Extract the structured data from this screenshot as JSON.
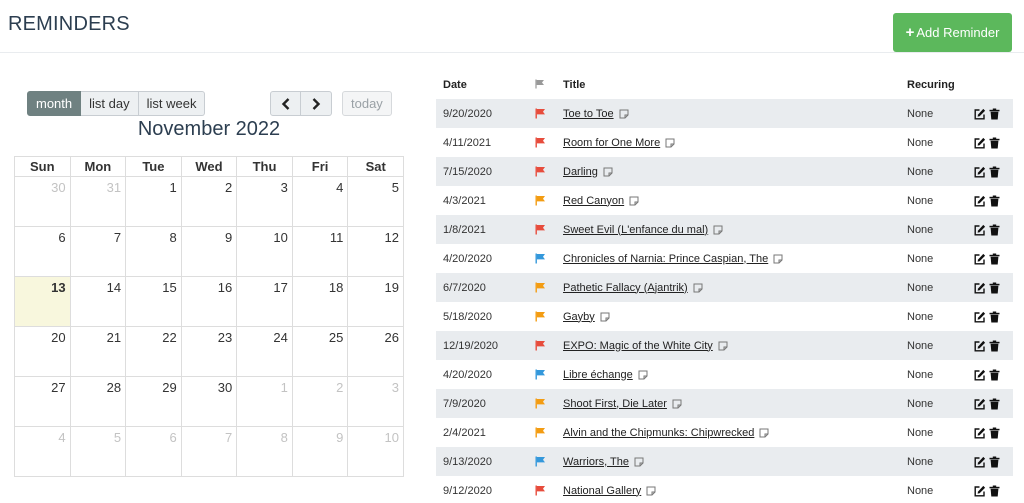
{
  "header": {
    "title": "REMINDERS",
    "add_button": "Add Reminder"
  },
  "colors": {
    "accent_green": "#5cb85c",
    "active_view": "#6f8181",
    "today_highlight": "#f8f7dd",
    "flag_red": "#e74c3c",
    "flag_orange": "#f39c12",
    "flag_blue": "#3498db",
    "stripe": "#e9ecef"
  },
  "calendar": {
    "views": [
      "month",
      "list day",
      "list week"
    ],
    "active_view": "month",
    "today_label": "today",
    "title": "November 2022",
    "weekdays": [
      "Sun",
      "Mon",
      "Tue",
      "Wed",
      "Thu",
      "Fri",
      "Sat"
    ],
    "weeks": [
      [
        {
          "d": "30",
          "o": true
        },
        {
          "d": "31",
          "o": true
        },
        {
          "d": "1"
        },
        {
          "d": "2"
        },
        {
          "d": "3"
        },
        {
          "d": "4"
        },
        {
          "d": "5"
        }
      ],
      [
        {
          "d": "6"
        },
        {
          "d": "7"
        },
        {
          "d": "8"
        },
        {
          "d": "9"
        },
        {
          "d": "10"
        },
        {
          "d": "11"
        },
        {
          "d": "12"
        }
      ],
      [
        {
          "d": "13",
          "t": true
        },
        {
          "d": "14"
        },
        {
          "d": "15"
        },
        {
          "d": "16"
        },
        {
          "d": "17"
        },
        {
          "d": "18"
        },
        {
          "d": "19"
        }
      ],
      [
        {
          "d": "20"
        },
        {
          "d": "21"
        },
        {
          "d": "22"
        },
        {
          "d": "23"
        },
        {
          "d": "24"
        },
        {
          "d": "25"
        },
        {
          "d": "26"
        }
      ],
      [
        {
          "d": "27"
        },
        {
          "d": "28"
        },
        {
          "d": "29"
        },
        {
          "d": "30"
        },
        {
          "d": "1",
          "o": true
        },
        {
          "d": "2",
          "o": true
        },
        {
          "d": "3",
          "o": true
        }
      ],
      [
        {
          "d": "4",
          "o": true
        },
        {
          "d": "5",
          "o": true
        },
        {
          "d": "6",
          "o": true
        },
        {
          "d": "7",
          "o": true
        },
        {
          "d": "8",
          "o": true
        },
        {
          "d": "9",
          "o": true
        },
        {
          "d": "10",
          "o": true
        }
      ]
    ]
  },
  "reminders": {
    "columns": {
      "date": "Date",
      "flag_icon": "flag-icon",
      "title": "Title",
      "recurring": "Recuring"
    },
    "rows": [
      {
        "date": "9/20/2020",
        "flag": "red",
        "title": "Toe to Toe",
        "recurring": "None"
      },
      {
        "date": "4/11/2021",
        "flag": "red",
        "title": "Room for One More",
        "recurring": "None"
      },
      {
        "date": "7/15/2020",
        "flag": "red",
        "title": "Darling",
        "recurring": "None"
      },
      {
        "date": "4/3/2021",
        "flag": "orange",
        "title": "Red Canyon",
        "recurring": "None"
      },
      {
        "date": "1/8/2021",
        "flag": "red",
        "title": "Sweet Evil (L'enfance du mal)",
        "recurring": "None"
      },
      {
        "date": "4/20/2020",
        "flag": "blue",
        "title": "Chronicles of Narnia: Prince Caspian, The",
        "recurring": "None"
      },
      {
        "date": "6/7/2020",
        "flag": "orange",
        "title": "Pathetic Fallacy (Ajantrik)",
        "recurring": "None"
      },
      {
        "date": "5/18/2020",
        "flag": "orange",
        "title": "Gayby",
        "recurring": "None"
      },
      {
        "date": "12/19/2020",
        "flag": "red",
        "title": "EXPO: Magic of the White City",
        "recurring": "None"
      },
      {
        "date": "4/20/2020",
        "flag": "blue",
        "title": "Libre échange",
        "recurring": "None"
      },
      {
        "date": "7/9/2020",
        "flag": "orange",
        "title": "Shoot First, Die Later",
        "recurring": "None"
      },
      {
        "date": "2/4/2021",
        "flag": "orange",
        "title": "Alvin and the Chipmunks: Chipwrecked",
        "recurring": "None"
      },
      {
        "date": "9/13/2020",
        "flag": "blue",
        "title": "Warriors, The",
        "recurring": "None"
      },
      {
        "date": "9/12/2020",
        "flag": "red",
        "title": "National Gallery",
        "recurring": "None"
      }
    ]
  }
}
